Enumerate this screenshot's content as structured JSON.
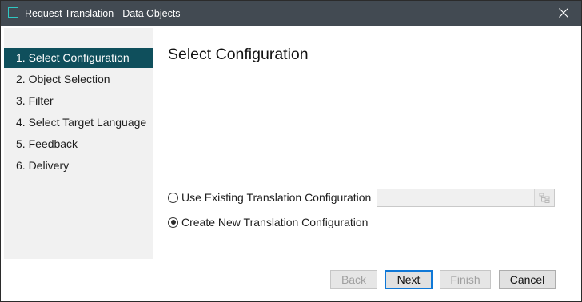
{
  "window": {
    "title": "Request Translation - Data Objects"
  },
  "steps": [
    {
      "label": "1. Select Configuration",
      "active": true
    },
    {
      "label": "2. Object Selection"
    },
    {
      "label": "3. Filter"
    },
    {
      "label": "4. Select Target Language"
    },
    {
      "label": "5. Feedback"
    },
    {
      "label": "6. Delivery"
    }
  ],
  "main": {
    "title": "Select Configuration",
    "options": {
      "use_existing": {
        "label": "Use Existing Translation Configuration",
        "selected": false,
        "field_value": ""
      },
      "create_new": {
        "label": "Create New Translation Configuration",
        "selected": true
      }
    }
  },
  "buttons": {
    "back": {
      "label": "Back",
      "enabled": false
    },
    "next": {
      "label": "Next",
      "enabled": true
    },
    "finish": {
      "label": "Finish",
      "enabled": false
    },
    "cancel": {
      "label": "Cancel",
      "enabled": true
    }
  },
  "colors": {
    "titlebar": "#424a52",
    "active_step": "#0f4f5c",
    "accent_icon": "#2fc7c2",
    "focus_border": "#0f78d7"
  },
  "icons": {
    "app": "app-window-icon",
    "close": "close-icon",
    "browse": "tree-browse-icon"
  }
}
